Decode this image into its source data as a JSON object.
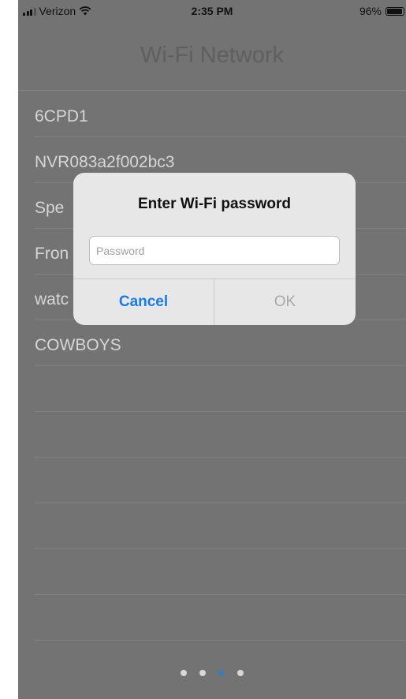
{
  "status_bar": {
    "carrier": "Verizon",
    "time": "2:35 PM",
    "battery_percent": "96%",
    "battery_level": 0.96,
    "icons": [
      "signal-icon",
      "wifi-icon",
      "battery-icon"
    ]
  },
  "nav": {
    "title": "Wi-Fi Network"
  },
  "networks": [
    {
      "label": "6CPD1"
    },
    {
      "label": "NVR083a2f002bc3"
    },
    {
      "label": "Spe"
    },
    {
      "label": "Fron"
    },
    {
      "label": "watc"
    },
    {
      "label": "COWBOYS"
    },
    {
      "label": ""
    },
    {
      "label": ""
    },
    {
      "label": ""
    },
    {
      "label": ""
    },
    {
      "label": ""
    },
    {
      "label": ""
    }
  ],
  "alert": {
    "title": "Enter Wi-Fi password",
    "password_placeholder": "Password",
    "password_value": "",
    "cancel_label": "Cancel",
    "ok_label": "OK"
  },
  "pager": {
    "page_count": 4,
    "current_page": 3
  },
  "colors": {
    "overlay_background": "#737373",
    "alert_background": "#e7e7e7",
    "accent": "#1a7ae6",
    "active_dot": "#3d7db3"
  }
}
